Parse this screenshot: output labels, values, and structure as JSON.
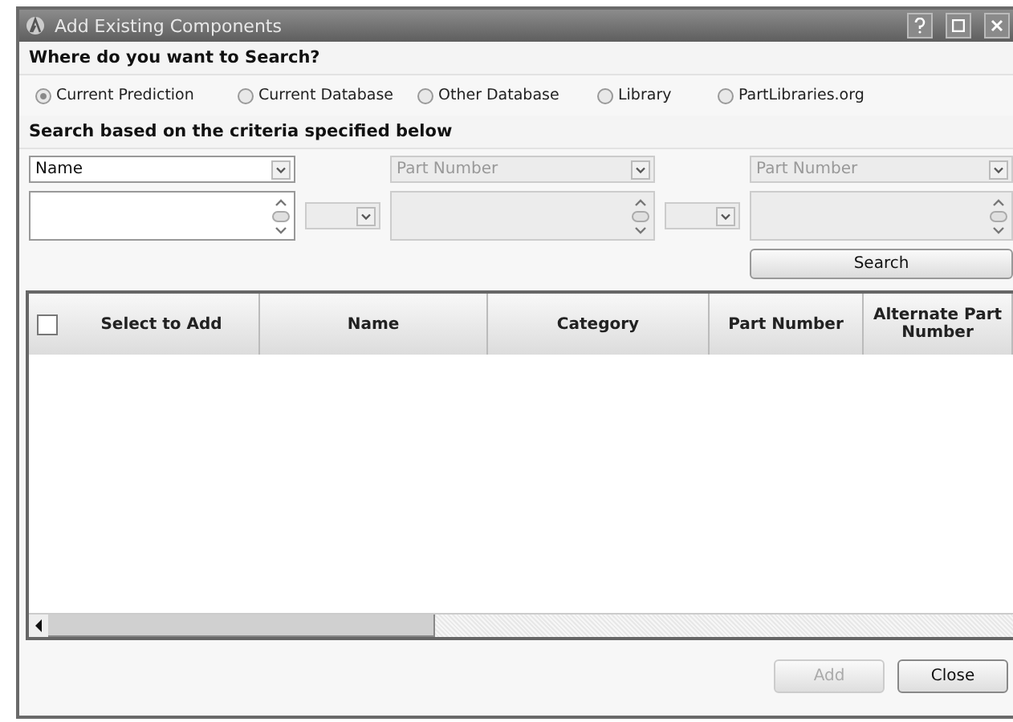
{
  "window": {
    "title": "Add Existing Components"
  },
  "search_location": {
    "heading": "Where do you want to Search?",
    "options": [
      {
        "label": "Current Prediction",
        "selected": true
      },
      {
        "label": "Current Database",
        "selected": false
      },
      {
        "label": "Other Database",
        "selected": false
      },
      {
        "label": "Library",
        "selected": false
      },
      {
        "label": "PartLibraries.org",
        "selected": false
      }
    ]
  },
  "criteria": {
    "heading": "Search based on the criteria specified below",
    "fields": [
      {
        "value": "Name",
        "disabled": false
      },
      {
        "value": "Part Number",
        "disabled": true
      },
      {
        "value": "Part Number",
        "disabled": true
      }
    ],
    "values": [
      {
        "disabled": false
      },
      {
        "disabled": true
      },
      {
        "disabled": true
      }
    ],
    "joins": [
      {
        "disabled": true
      },
      {
        "disabled": true
      }
    ],
    "search_button": "Search"
  },
  "table": {
    "select_all": {
      "checked": false
    },
    "columns": [
      "Select to Add",
      "Name",
      "Category",
      "Part Number",
      "Alternate Part Number"
    ]
  },
  "buttons": [
    {
      "label": "Add",
      "disabled": true
    },
    {
      "label": "Close",
      "disabled": false
    }
  ]
}
